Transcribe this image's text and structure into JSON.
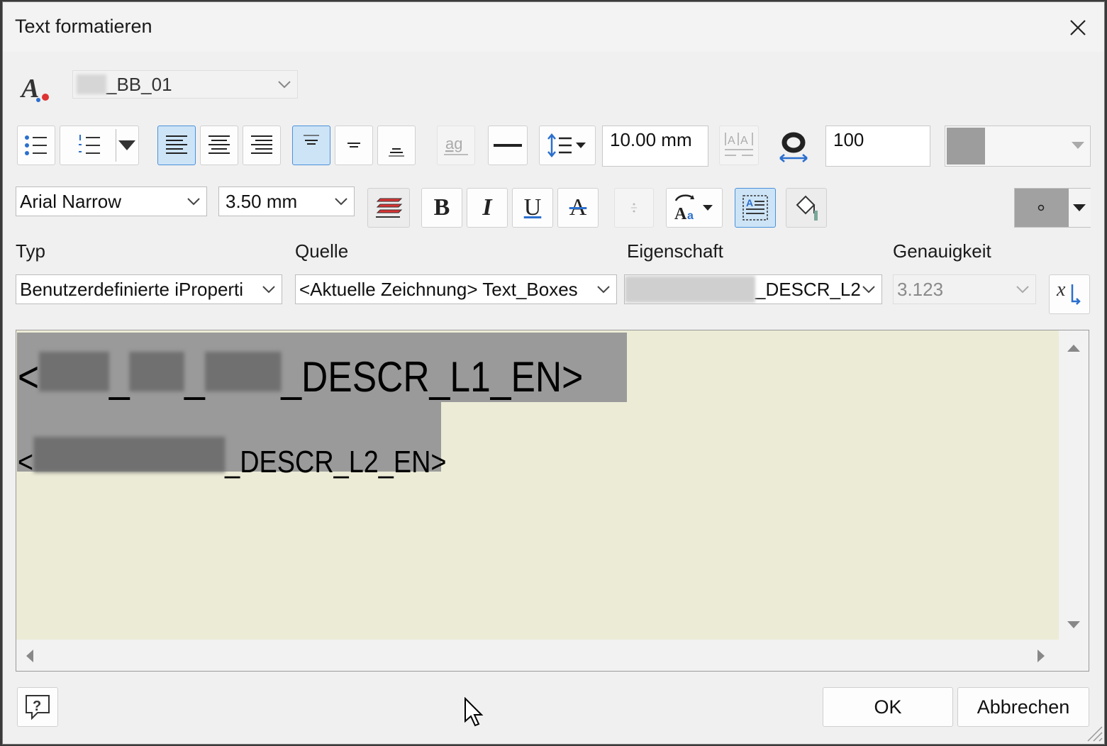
{
  "window": {
    "title": "Text formatieren"
  },
  "style_combo": {
    "value": "_BB_01"
  },
  "toolbar1": {
    "line_spacing_value": "10.00 mm",
    "width_scale_value": "100"
  },
  "toolbar2": {
    "font": "Arial Narrow",
    "size": "3.50 mm",
    "bold_label": "B",
    "italic_label": "I",
    "underline_label": "U",
    "strike_label": "A"
  },
  "fields": {
    "typ_label": "Typ",
    "typ_value": "Benutzerdefinierte iProperti",
    "quelle_label": "Quelle",
    "quelle_value": "<Aktuelle Zeichnung> Text_Boxes",
    "eigenschaft_label": "Eigenschaft",
    "eigenschaft_value": "_DESCR_L2",
    "genauigkeit_label": "Genauigkeit",
    "genauigkeit_value": "3.123"
  },
  "editor": {
    "line1_open": "<",
    "line1_sep1": "_",
    "line1_sep2": "_",
    "line1_text": "_DESCR_L1_EN>",
    "line2_open": "<",
    "line2_text": "_DESCR_L2_EN>"
  },
  "footer": {
    "ok": "OK",
    "cancel": "Abbrechen"
  },
  "colors": {
    "accent": "#4a90d9",
    "editor_bg": "#ecebd6",
    "selection": "#9a9a9a"
  }
}
